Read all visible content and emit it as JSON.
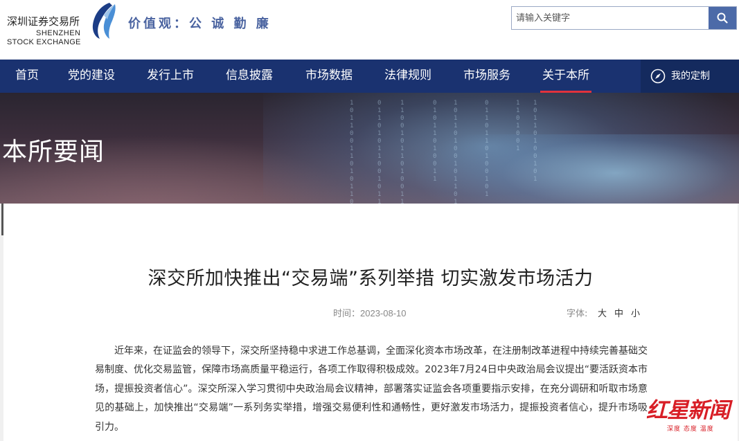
{
  "header": {
    "logo_cn": "深圳证券交易所",
    "logo_en_1": "SHENZHEN",
    "logo_en_2": "STOCK EXCHANGE",
    "slogan": "价值观：公 诚 勤 廉",
    "search": {
      "placeholder": "请输入关键字"
    }
  },
  "nav": {
    "items": [
      {
        "label": "首页"
      },
      {
        "label": "党的建设"
      },
      {
        "label": "发行上市"
      },
      {
        "label": "信息披露"
      },
      {
        "label": "市场数据"
      },
      {
        "label": "法律规则"
      },
      {
        "label": "市场服务"
      },
      {
        "label": "关于本所",
        "active": true
      }
    ],
    "custom_label": "我的定制"
  },
  "banner": {
    "title": "本所要闻"
  },
  "article": {
    "title": "深交所加快推出“交易端”系列举措 切实激发市场活力",
    "time_label": "时间：",
    "time_value": "2023-08-10",
    "font_label": "字体:",
    "font_sizes": [
      "大",
      "中",
      "小"
    ],
    "paragraph": "近年来，在证监会的领导下，深交所坚持稳中求进工作总基调，全面深化资本市场改革，在注册制改革进程中持续完善基础交易制度、优化交易监管，保障市场高质量平稳运行，各项工作取得积极成效。2023年7月24日中央政治局会议提出“要活跃资本市场，提振投资者信心”。深交所深入学习贯彻中央政治局会议精神，部署落实证监会各项重要指示安排，在充分调研和听取市场意见的基础上，加快推出“交易端”一系列务实举措，增强交易便利性和通畅性，更好激发市场活力，提振投资者信心，提升市场吸引力。"
  },
  "watermark": {
    "text": "红星新闻",
    "sub": "深度 态度 温度"
  },
  "colors": {
    "nav_bg": "#1a3270",
    "active_underline": "#e1323c",
    "search_btn": "#4c6aa8",
    "slogan": "#4a63a0",
    "watermark": "#d81e26"
  }
}
